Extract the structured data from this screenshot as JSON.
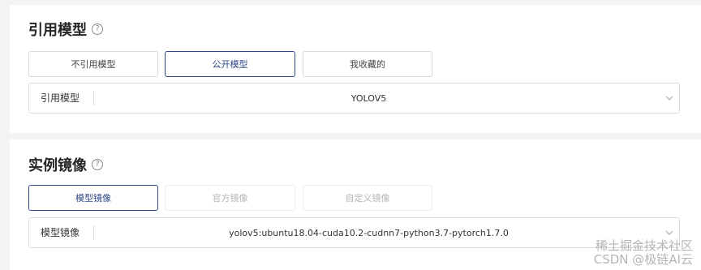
{
  "reference_model": {
    "title": "引用模型",
    "help_icon": "question-circle-icon",
    "options": [
      "不引用模型",
      "公开模型",
      "我收藏的"
    ],
    "selected_option": "公开模型",
    "select_label": "引用模型",
    "select_value": "YOLOV5"
  },
  "instance_image": {
    "title": "实例镜像",
    "help_icon": "question-circle-icon",
    "options": [
      "模型镜像",
      "官方镜像",
      "自定义镜像"
    ],
    "selected_option": "模型镜像",
    "select_label": "模型镜像",
    "select_value": "yolov5:ubuntu18.04-cuda10.2-cudnn7-python3.7-pytorch1.7.0"
  },
  "watermark": {
    "line1": "稀土掘金技术社区",
    "line2": "CSDN @极链AI云"
  },
  "colors": {
    "accent": "#2f4a8a",
    "background": "#f2f3f5",
    "card": "#ffffff"
  }
}
